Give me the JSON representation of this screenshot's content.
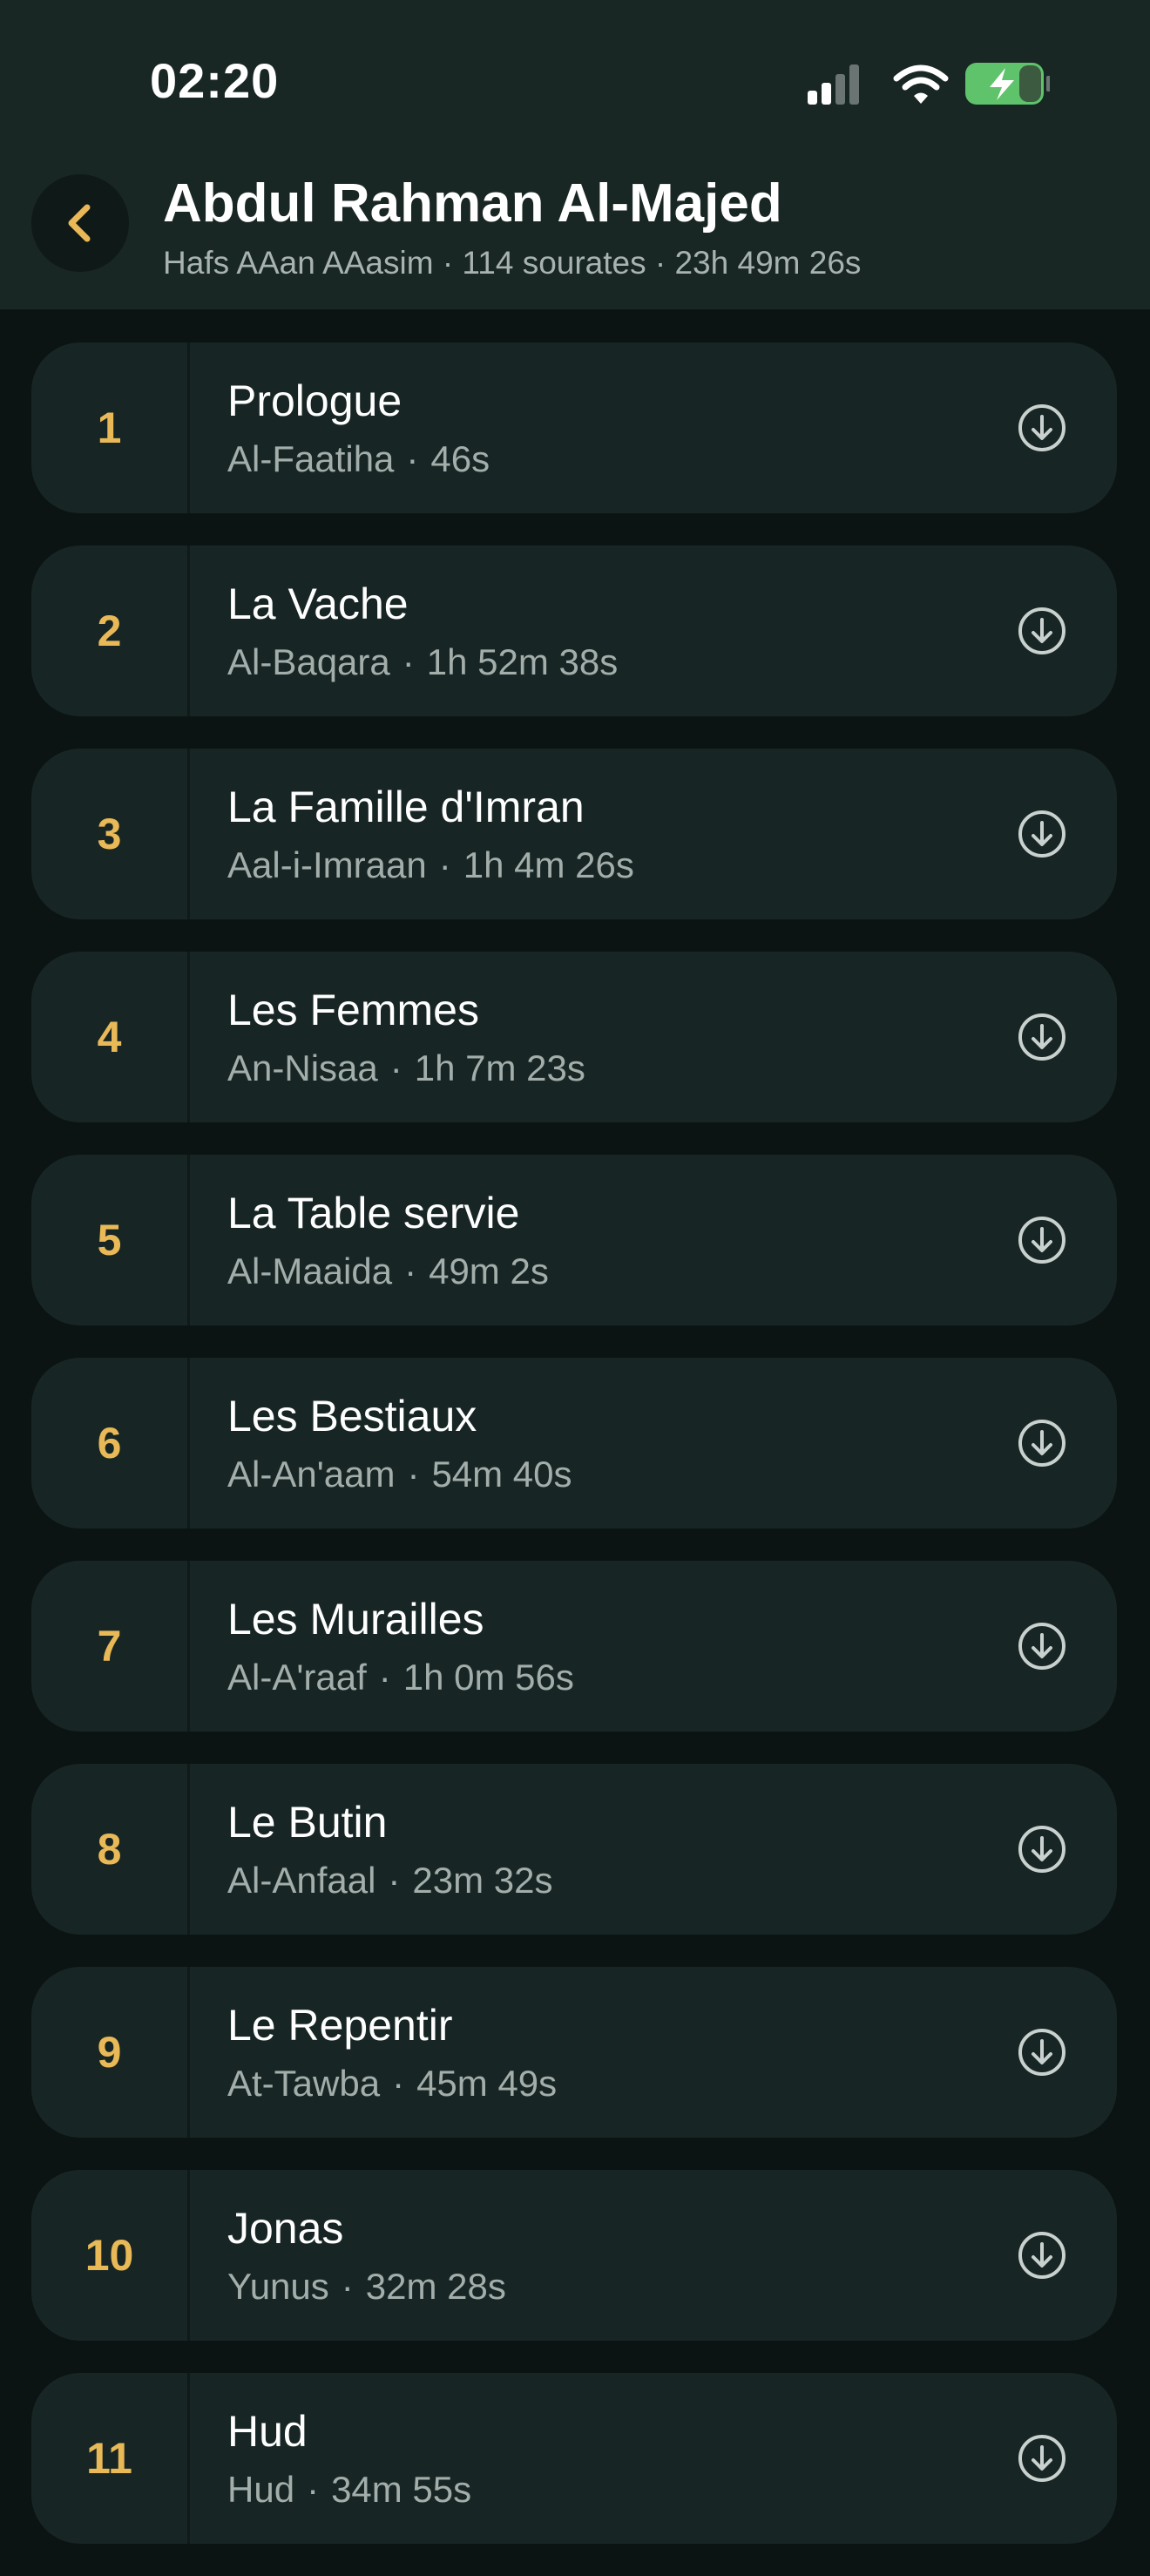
{
  "status_bar": {
    "time": "02:20"
  },
  "header": {
    "title": "Abdul Rahman Al-Majed",
    "subtitle": "Hafs AAan AAasim · 114 sourates · 23h 49m 26s"
  },
  "colors": {
    "accent": "#e9b957",
    "battery": "#5fc36b",
    "background": "#0b1413",
    "card": "#172624"
  },
  "surahs": [
    {
      "number": "1",
      "name": "Prologue",
      "transliteration": "Al-Faatiha",
      "duration": "46s"
    },
    {
      "number": "2",
      "name": "La Vache",
      "transliteration": "Al-Baqara",
      "duration": "1h 52m 38s"
    },
    {
      "number": "3",
      "name": "La Famille d'Imran",
      "transliteration": "Aal-i-Imraan",
      "duration": "1h 4m 26s"
    },
    {
      "number": "4",
      "name": "Les Femmes",
      "transliteration": "An-Nisaa",
      "duration": "1h 7m 23s"
    },
    {
      "number": "5",
      "name": "La Table servie",
      "transliteration": "Al-Maaida",
      "duration": "49m 2s"
    },
    {
      "number": "6",
      "name": "Les Bestiaux",
      "transliteration": "Al-An'aam",
      "duration": "54m 40s"
    },
    {
      "number": "7",
      "name": "Les Murailles",
      "transliteration": "Al-A'raaf",
      "duration": "1h 0m 56s"
    },
    {
      "number": "8",
      "name": "Le Butin",
      "transliteration": "Al-Anfaal",
      "duration": "23m 32s"
    },
    {
      "number": "9",
      "name": "Le Repentir",
      "transliteration": "At-Tawba",
      "duration": "45m 49s"
    },
    {
      "number": "10",
      "name": "Jonas",
      "transliteration": "Yunus",
      "duration": "32m 28s"
    },
    {
      "number": "11",
      "name": "Hud",
      "transliteration": "Hud",
      "duration": "34m 55s"
    }
  ],
  "icons": {
    "back": "chevron-left-icon",
    "download": "download-circle-icon",
    "signal": "cellular-signal-icon",
    "wifi": "wifi-icon",
    "battery": "battery-charging-icon"
  }
}
